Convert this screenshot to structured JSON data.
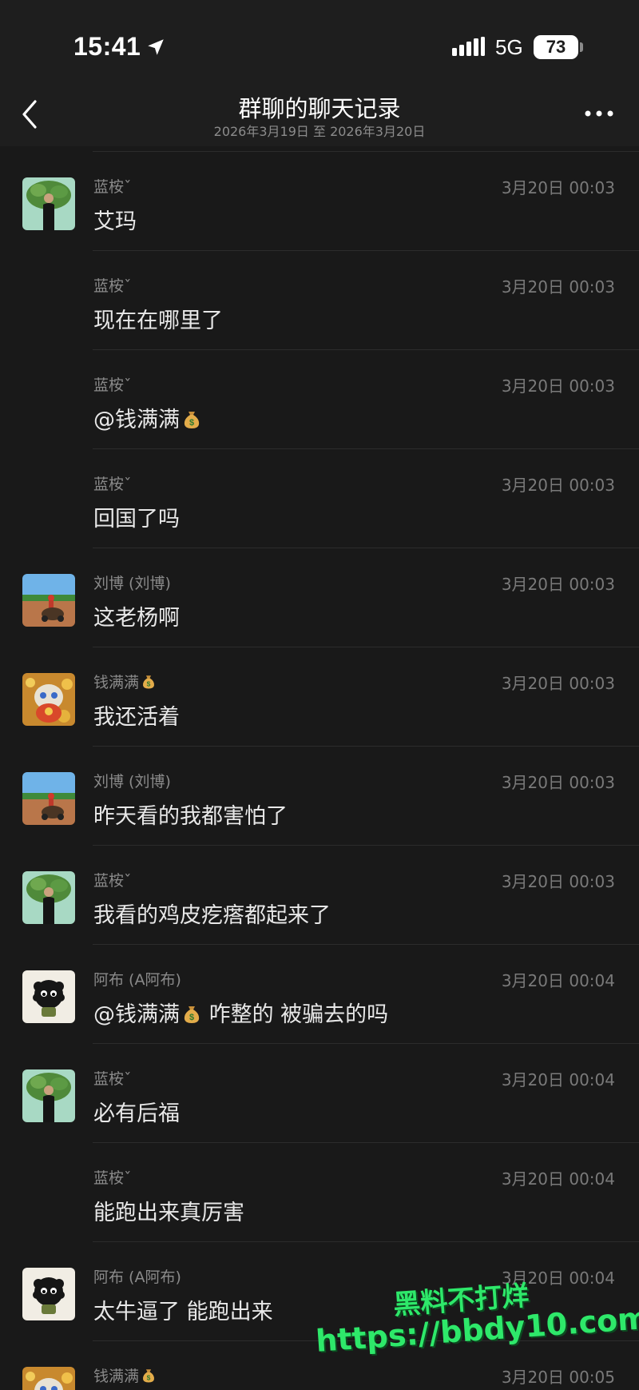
{
  "status_bar": {
    "time": "15:41",
    "network": "5G",
    "battery": "73"
  },
  "header": {
    "title": "群聊的聊天记录",
    "subtitle": "2026年3月19日 至 2026年3月20日"
  },
  "messages": [
    {
      "sender": "蓝桉ˇ",
      "time": "3月20日 00:03",
      "text": "艾玛",
      "avatar": "avatar-lanan"
    },
    {
      "sender": "蓝桉ˇ",
      "time": "3月20日 00:03",
      "text": "现在在哪里了",
      "avatar": null
    },
    {
      "sender": "蓝桉ˇ",
      "time": "3月20日 00:03",
      "text": "@钱满满",
      "text_emoji": "money-bag",
      "avatar": null
    },
    {
      "sender": "蓝桉ˇ",
      "time": "3月20日 00:03",
      "text": "回国了吗",
      "avatar": null
    },
    {
      "sender": "刘博 (刘博)",
      "time": "3月20日 00:03",
      "text": "这老杨啊",
      "avatar": "avatar-liubo"
    },
    {
      "sender": "钱满满",
      "sender_emoji": "money-bag",
      "time": "3月20日 00:03",
      "text": "我还活着",
      "avatar": "avatar-qianmanman"
    },
    {
      "sender": "刘博 (刘博)",
      "time": "3月20日 00:03",
      "text": "昨天看的我都害怕了",
      "avatar": "avatar-liubo"
    },
    {
      "sender": "蓝桉ˇ",
      "time": "3月20日 00:03",
      "text": "我看的鸡皮疙瘩都起来了",
      "avatar": "avatar-lanan"
    },
    {
      "sender": "阿布 (A阿布)",
      "time": "3月20日 00:04",
      "text": "@钱满满",
      "text_emoji": "money-bag",
      "text_after": " 咋整的 被骗去的吗",
      "avatar": "avatar-abu"
    },
    {
      "sender": "蓝桉ˇ",
      "time": "3月20日 00:04",
      "text": "必有后福",
      "avatar": "avatar-lanan"
    },
    {
      "sender": "蓝桉ˇ",
      "time": "3月20日 00:04",
      "text": "能跑出来真厉害",
      "avatar": null
    },
    {
      "sender": "阿布 (A阿布)",
      "time": "3月20日 00:04",
      "text": "太牛逼了 能跑出来",
      "avatar": "avatar-abu"
    },
    {
      "sender": "钱满满",
      "sender_emoji": "money-bag",
      "time": "3月20日 00:05",
      "text": "",
      "avatar": "avatar-qianmanman"
    }
  ],
  "watermark": {
    "line1": "黑料不打烊",
    "line2": "https://bbdy10.com"
  },
  "colors": {
    "background": "#191919",
    "header_bg": "#1e1e1e",
    "watermark": "#2ee86a"
  }
}
